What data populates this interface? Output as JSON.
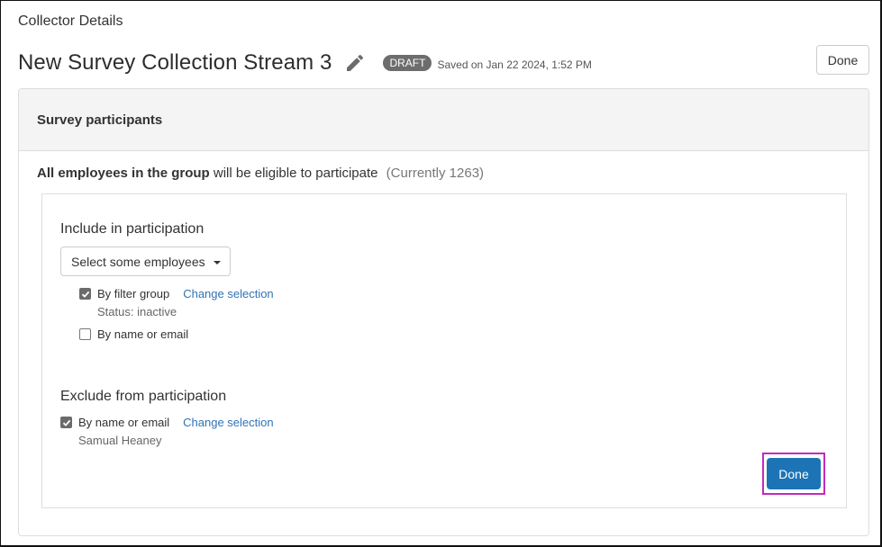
{
  "page": {
    "label": "Collector Details",
    "title": "New Survey Collection Stream 3",
    "status_badge": "DRAFT",
    "saved_text": "Saved on Jan 22 2024, 1:52 PM",
    "done_label": "Done",
    "icons": {
      "edit": "pencil-icon"
    }
  },
  "panel": {
    "title": "Survey participants",
    "eligibility": {
      "bold": "All employees in the group",
      "rest": " will be eligible to participate",
      "count": "(Currently 1263)"
    },
    "include": {
      "title": "Include in participation",
      "dropdown_value": "Select some employees",
      "options": [
        {
          "label": "By filter group",
          "checked": true,
          "link": "Change selection",
          "sub": "Status: inactive"
        },
        {
          "label": "By name or email",
          "checked": false
        }
      ]
    },
    "exclude": {
      "title": "Exclude from participation",
      "options": [
        {
          "label": "By name or email",
          "checked": true,
          "link": "Change selection",
          "sub": "Samual Heaney"
        }
      ]
    },
    "done_label": "Done"
  },
  "colors": {
    "primary_button": "#1c74b6",
    "link": "#2f74b5",
    "highlight_border": "#c12bbd",
    "badge": "#6d6d6d"
  }
}
